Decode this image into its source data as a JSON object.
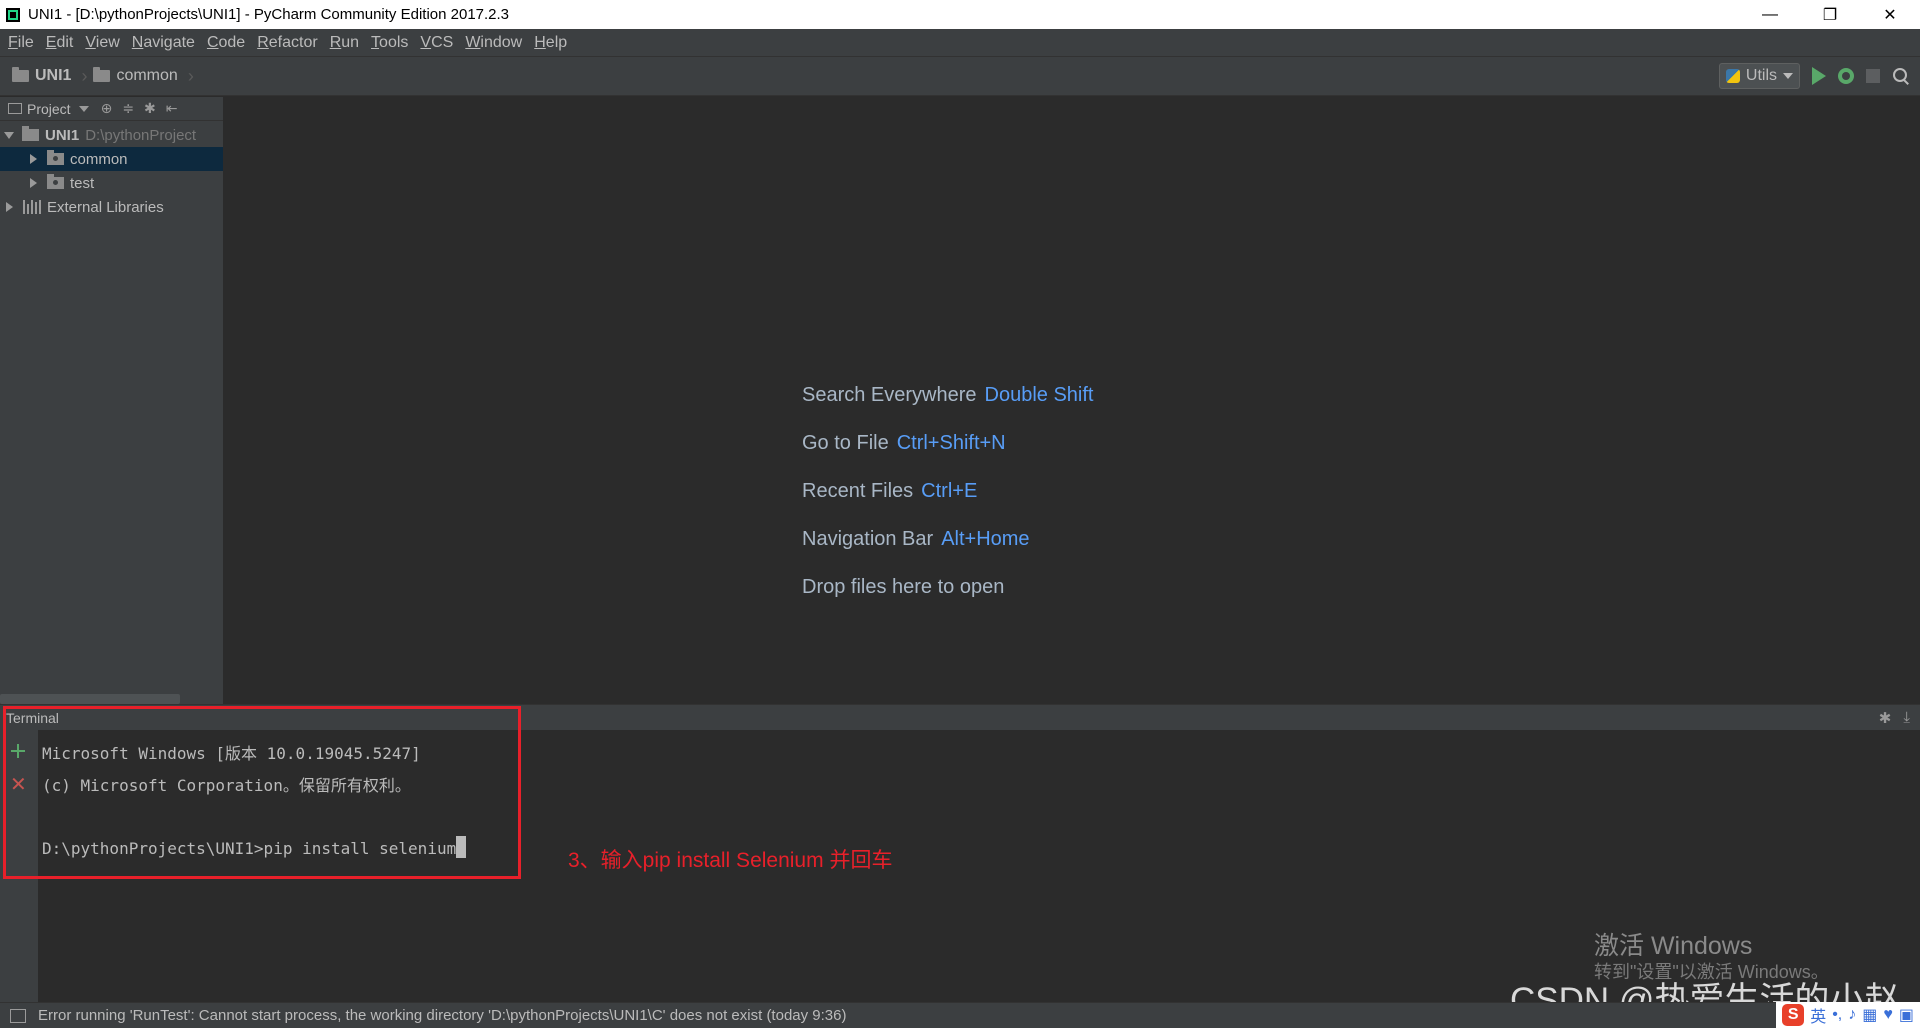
{
  "window": {
    "title": "UNI1 - [D:\\pythonProjects\\UNI1] - PyCharm Community Edition 2017.2.3",
    "minimize_glyph": "—",
    "restore_glyph": "❐",
    "close_glyph": "✕"
  },
  "menu": {
    "items": [
      {
        "u": "F",
        "rest": "ile"
      },
      {
        "u": "E",
        "rest": "dit"
      },
      {
        "u": "V",
        "rest": "iew"
      },
      {
        "u": "N",
        "rest": "avigate"
      },
      {
        "u": "C",
        "rest": "ode"
      },
      {
        "u": "R",
        "rest": "efactor"
      },
      {
        "u": "R",
        "rest": "un"
      },
      {
        "u": "T",
        "rest": "ools"
      },
      {
        "u": "V",
        "rest": "CS"
      },
      {
        "u": "W",
        "rest": "indow"
      },
      {
        "u": "H",
        "rest": "elp"
      }
    ]
  },
  "navbar": {
    "project": "UNI1",
    "folder": "common",
    "run_config": "Utils"
  },
  "project_panel": {
    "header": "Project",
    "root_name": "UNI1",
    "root_path": "D:\\pythonProject",
    "items": [
      "common",
      "test"
    ],
    "libraries": "External Libraries"
  },
  "editor_hints": [
    {
      "label": "Search Everywhere",
      "key": "Double Shift"
    },
    {
      "label": "Go to File",
      "key": "Ctrl+Shift+N"
    },
    {
      "label": "Recent Files",
      "key": "Ctrl+E"
    },
    {
      "label": "Navigation Bar",
      "key": "Alt+Home"
    },
    {
      "label": "Drop files here to open",
      "key": ""
    }
  ],
  "terminal": {
    "title": "Terminal",
    "lines": [
      "Microsoft Windows [版本 10.0.19045.5247]",
      "(c) Microsoft Corporation。保留所有权利。",
      "D:\\pythonProjects\\UNI1>pip install selenium"
    ]
  },
  "annotation": "3、输入pip install Selenium 并回车",
  "watermark": {
    "activate_title": "激活 Windows",
    "activate_sub": "转到\"设置\"以激活 Windows。",
    "csdn": "CSDN @热爱生活的小赵"
  },
  "status": {
    "message": "Error running 'RunTest': Cannot start process, the working directory 'D:\\pythonProjects\\UNI1\\C' does not exist (today 9:36)"
  },
  "ime": {
    "logo": "S",
    "lang": "英"
  },
  "colors": {
    "accent_key": "#589df6",
    "annotation_red": "#e8202a",
    "run_green": "#59a869"
  }
}
